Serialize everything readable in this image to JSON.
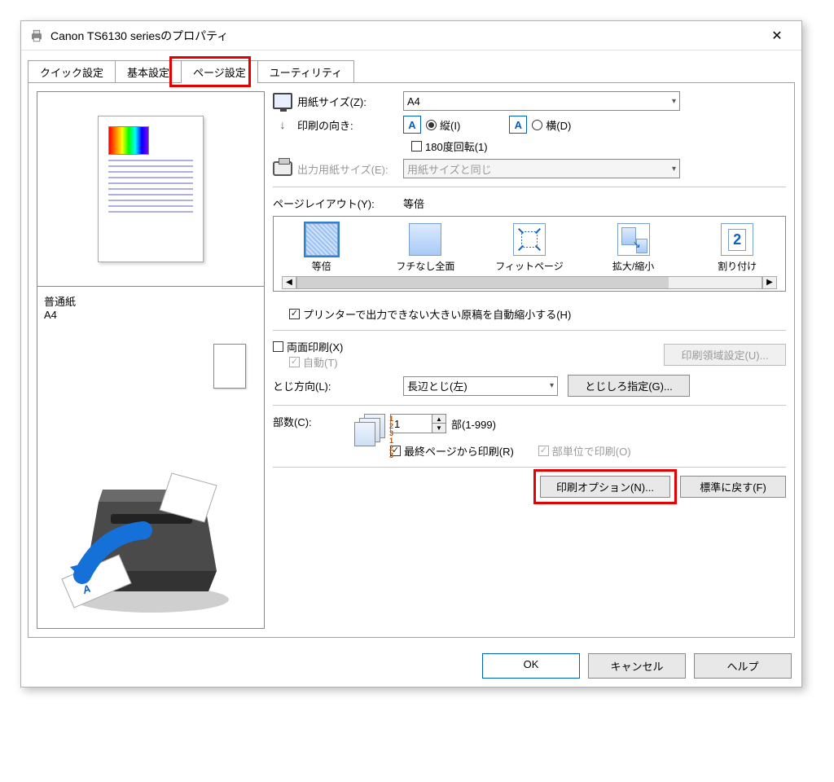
{
  "window": {
    "title": "Canon TS6130 seriesのプロパティ"
  },
  "tabs": {
    "quick": "クイック設定",
    "basic": "基本設定",
    "page": "ページ設定",
    "utility": "ユーティリティ"
  },
  "preview": {
    "paper_type": "普通紙",
    "paper_size": "A4"
  },
  "page_size": {
    "label": "用紙サイズ(Z):",
    "value": "A4"
  },
  "orientation": {
    "label": "印刷の向き:",
    "portrait": "縦(I)",
    "landscape": "横(D)",
    "rotate180": "180度回転(1)"
  },
  "output_size": {
    "label": "出力用紙サイズ(E):",
    "value": "用紙サイズと同じ"
  },
  "layout": {
    "label": "ページレイアウト(Y):",
    "current": "等倍",
    "items": [
      "等倍",
      "フチなし全面",
      "フィットページ",
      "拡大/縮小",
      "割り付け"
    ]
  },
  "auto_reduce": "プリンターで出力できない大きい原稿を自動縮小する(H)",
  "duplex": {
    "label": "両面印刷(X)",
    "auto": "自動(T)",
    "area_btn": "印刷領域設定(U)..."
  },
  "binding": {
    "label": "とじ方向(L):",
    "value": "長辺とじ(左)",
    "margin_btn": "とじしろ指定(G)..."
  },
  "copies": {
    "label": "部数(C):",
    "value": "1",
    "range": "部(1-999)",
    "reverse": "最終ページから印刷(R)",
    "collate": "部単位で印刷(O)"
  },
  "buttons": {
    "print_options": "印刷オプション(N)...",
    "defaults": "標準に戻す(F)",
    "ok": "OK",
    "cancel": "キャンセル",
    "help": "ヘルプ"
  }
}
